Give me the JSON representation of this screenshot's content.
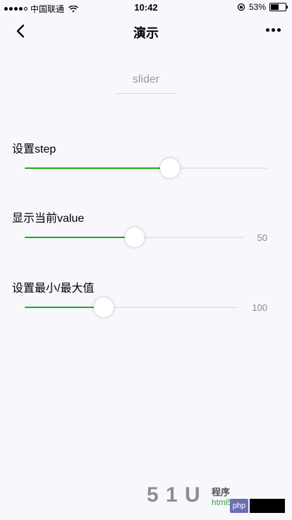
{
  "status_bar": {
    "carrier": "中国联通",
    "time": "10:42",
    "battery": "53%",
    "battery_level": 0.53,
    "signal_icon": "signal-dots-icon",
    "wifi_icon": "wifi-icon",
    "orientation_icon": "orientation-lock-icon"
  },
  "nav": {
    "title": "演示",
    "back_icon": "chevron-left-icon",
    "more_icon": "more-dots-icon"
  },
  "page": {
    "heading": "slider"
  },
  "sliders": [
    {
      "label": "设置step",
      "fraction": 0.6,
      "value_text": null
    },
    {
      "label": "显示当前value",
      "fraction": 0.5,
      "value_text": "50"
    },
    {
      "label": "设置最小/最大值",
      "fraction": 0.37,
      "value_text": "100"
    }
  ],
  "colors": {
    "accent": "#1aad19",
    "track": "#e6e6e6",
    "background": "#f8f7fc"
  },
  "watermark": {
    "text": "5 1 U",
    "small": "程序",
    "html": "html5",
    "php": "php"
  }
}
